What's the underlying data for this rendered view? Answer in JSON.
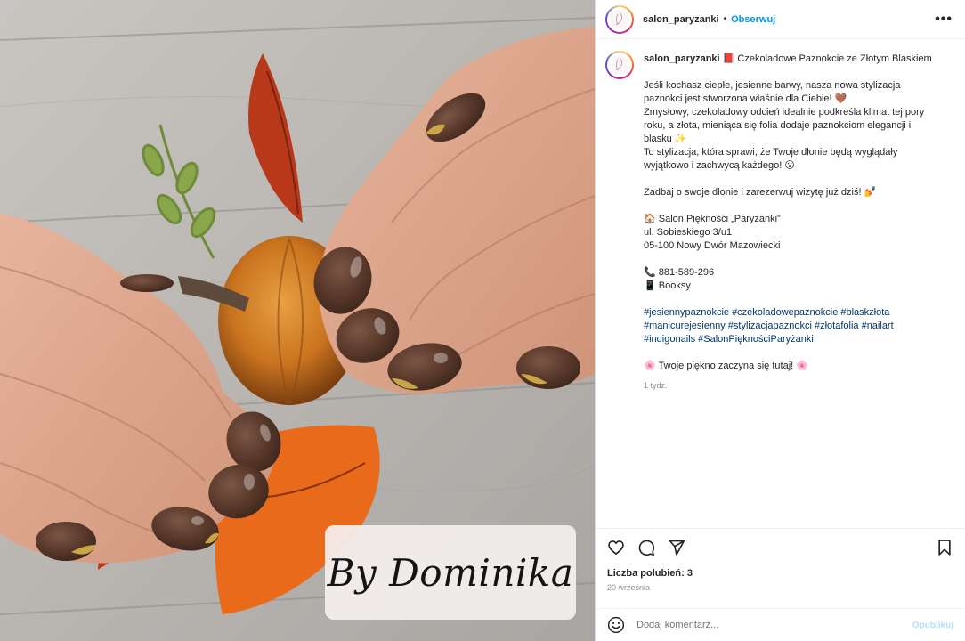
{
  "post": {
    "username": "salon_paryzanki",
    "follow_label": "Obserwuj",
    "more_label": "•••",
    "separator": "•",
    "photo_signature": "By Dominika"
  },
  "caption": {
    "username": "salon_paryzanki",
    "title": "📕 Czekoladowe Paznokcie ze Złotym Blaskiem",
    "para1": [
      "Jeśli kochasz ciepłe, jesienne barwy, nasza nowa stylizacja",
      "paznokci jest stworzona właśnie dla Ciebie! 🤎",
      "Zmysłowy, czekoladowy odcień idealnie podkreśla klimat tej pory",
      "roku, a złota, mieniąca się folia dodaje paznokciom elegancji i",
      "blasku ✨",
      "To stylizacja, która sprawi, że Twoje dłonie będą wyglądały",
      "wyjątkowo i zachwycą każdego! 😮"
    ],
    "cta": "Zadbaj o swoje dłonie i zarezerwuj wizytę już dziś! 💅",
    "address": [
      "🏠 Salon Piękności „Paryżanki”",
      "ul. Sobieskiego 3/u1",
      "05-100 Nowy Dwór Mazowiecki"
    ],
    "phone": "📞 881-589-296",
    "booking": "📱 Booksy",
    "hashtags": [
      "#jesiennypaznokcie #czekoladowepaznokcie #blaskzłota",
      "#manicurejesienny #stylizacjapaznokci #złotafolia #nailart",
      "#indigonails #SalonPięknościParyżanki"
    ],
    "closing": "🌸 Twoje piękno zaczyna się tutaj! 🌸",
    "time": "1 tydz."
  },
  "actions": {
    "likes": "Liczba polubień: 3",
    "date": "20 września",
    "icons": [
      "heart-icon",
      "comment-icon",
      "share-icon",
      "bookmark-icon"
    ]
  },
  "comment": {
    "placeholder": "Dodaj komentarz...",
    "publish": "Opublikuj",
    "emoji_icon": "smiley-icon"
  },
  "colors": {
    "accent": "#0095f6",
    "publish_disabled": "#b2dffc",
    "muted_text": "#8e8e8e",
    "hashtag": "#00376b"
  }
}
